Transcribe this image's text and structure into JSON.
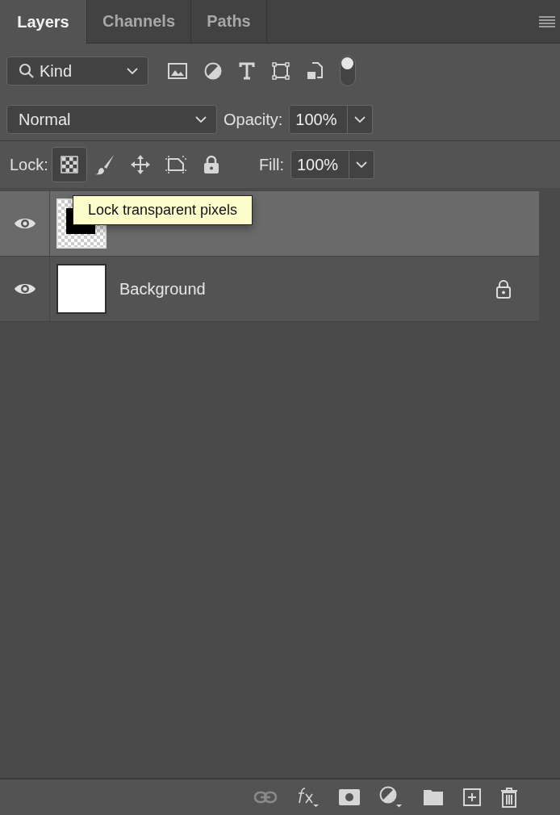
{
  "tabs": [
    {
      "label": "Layers",
      "selected": true
    },
    {
      "label": "Channels",
      "selected": false
    },
    {
      "label": "Paths",
      "selected": false
    }
  ],
  "filter": {
    "value": "Kind",
    "on": true
  },
  "blend_mode": {
    "value": "Normal"
  },
  "opacity": {
    "label": "Opacity:",
    "value": "100%"
  },
  "lock": {
    "label": "Lock:",
    "buttons": [
      {
        "kind": "transparent",
        "selected": true
      },
      {
        "kind": "image",
        "selected": false
      },
      {
        "kind": "position",
        "selected": false
      },
      {
        "kind": "artboard",
        "selected": false
      },
      {
        "kind": "all",
        "selected": false
      }
    ]
  },
  "fill": {
    "label": "Fill:",
    "value": "100%"
  },
  "layers": [
    {
      "kind": "shape",
      "selected": true,
      "visible": true,
      "locked": false
    },
    {
      "name": "Background",
      "kind": "white",
      "selected": false,
      "visible": true,
      "locked": true
    }
  ],
  "tooltip": {
    "text": "Lock transparent pixels"
  },
  "footer_buttons": [
    {
      "kind": "link",
      "disabled": true
    },
    {
      "kind": "fx",
      "disabled": false
    },
    {
      "kind": "mask",
      "disabled": false
    },
    {
      "kind": "adjustment",
      "disabled": false
    },
    {
      "kind": "group",
      "disabled": false
    },
    {
      "kind": "new",
      "disabled": false
    },
    {
      "kind": "delete",
      "disabled": false
    }
  ]
}
